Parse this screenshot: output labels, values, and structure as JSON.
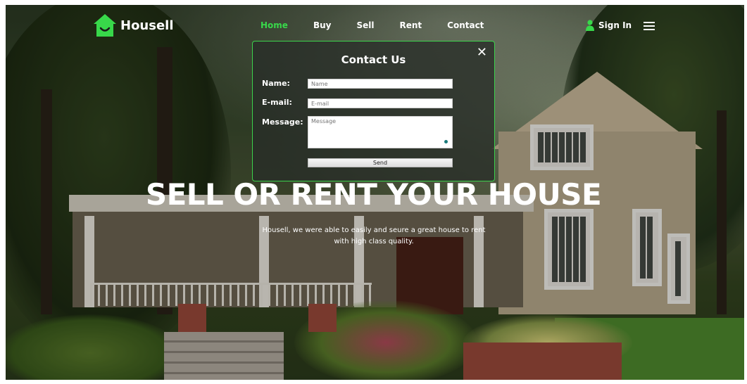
{
  "brand": {
    "name": "Housell",
    "accent": "#38d84a"
  },
  "nav": {
    "items": [
      {
        "label": "Home",
        "active": true
      },
      {
        "label": "Buy",
        "active": false
      },
      {
        "label": "Sell",
        "active": false
      },
      {
        "label": "Rent",
        "active": false
      },
      {
        "label": "Contact",
        "active": false
      }
    ],
    "signin_label": "Sign In",
    "signin_icon": "user-icon",
    "menu_icon": "hamburger-menu-icon"
  },
  "contact_modal": {
    "title": "Contact Us",
    "close_icon": "close-icon",
    "name_label": "Name:",
    "name_placeholder": "Name",
    "email_label": "E-mail:",
    "email_placeholder": "E-mail",
    "message_label": "Message:",
    "message_placeholder": "Message",
    "send_label": "Send",
    "border_color": "#3cd24c"
  },
  "hero": {
    "title": "SELL OR RENT YOUR HOUSE",
    "subtitle_line1": "Housell, we were able to easily and seure a great house to rent",
    "subtitle_line2": "with high class quality."
  }
}
